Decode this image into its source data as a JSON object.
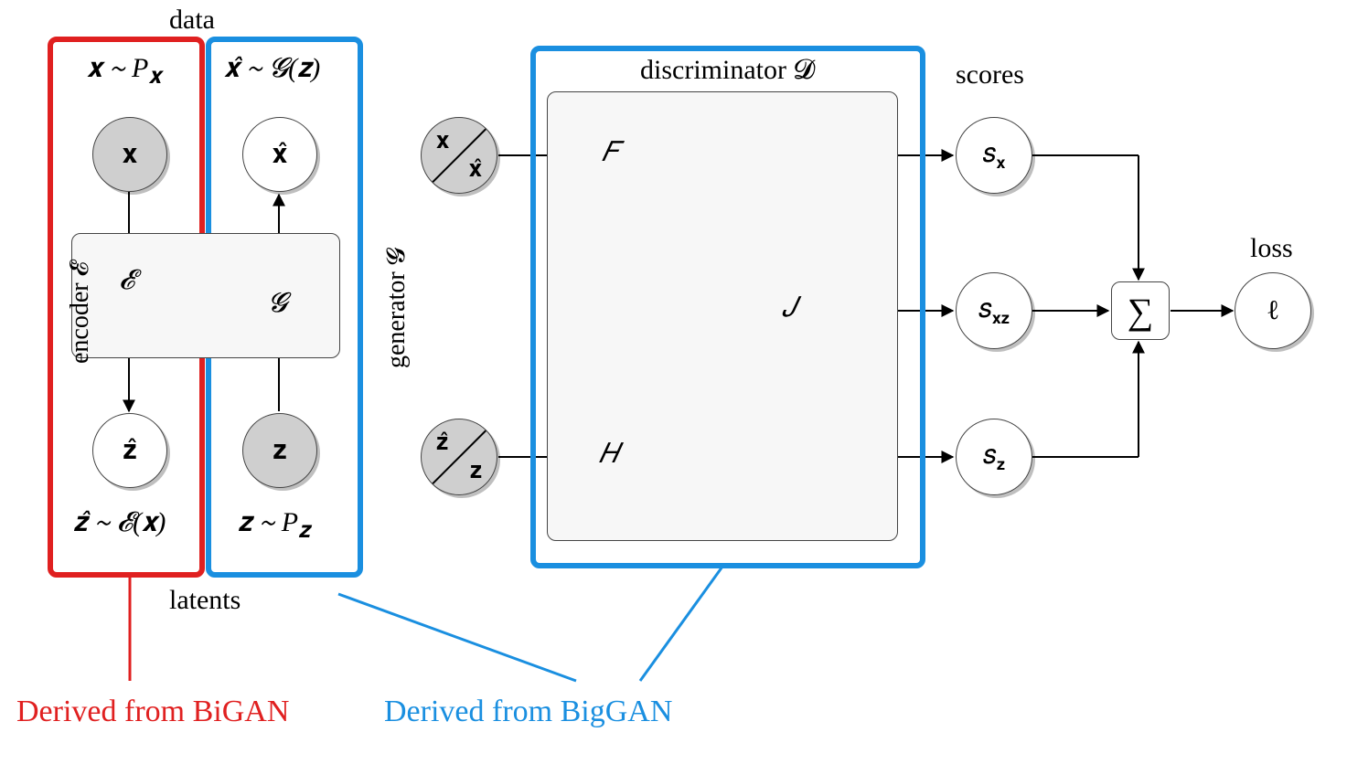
{
  "topLabels": {
    "data": "data",
    "discriminator": "discriminator 𝓓",
    "scores": "scores",
    "loss": "loss",
    "latents": "latents"
  },
  "sideLabels": {
    "encoder": "encoder 𝓔",
    "generator": "generator 𝓖"
  },
  "dists": {
    "x": "𝐱 ∼ 𝑃𝒙",
    "xhat": "𝐱̂ ∼ 𝓖(𝐳)",
    "zhat": "𝐳̂ ∼ 𝓔(𝐱)",
    "z": "𝐳 ∼ 𝑃𝒛"
  },
  "nodes": {
    "x": "𝐱",
    "xhat": "𝐱̂",
    "z": "𝐳",
    "zhat": "𝐳̂",
    "F": "𝐹",
    "H": "𝐻",
    "J": "𝐽",
    "E": "𝓔",
    "G": "𝓖",
    "sx": "𝑠𝐱",
    "sxz": "𝑠𝐱𝐳",
    "sz": "𝑠𝐳",
    "sum": "∑",
    "loss": "ℓ"
  },
  "split": {
    "top_top": "𝐱",
    "top_bot": "𝐱̂",
    "bot_top": "𝐳̂",
    "bot_bot": "𝐳"
  },
  "callouts": {
    "bigan": "Derived from BiGAN",
    "biggan": "Derived from BigGAN"
  },
  "colors": {
    "red": "#e02020",
    "blue": "#1a8fe0",
    "greenFill": "#e2f5e1",
    "purpleFill": "#e2e2f8"
  }
}
